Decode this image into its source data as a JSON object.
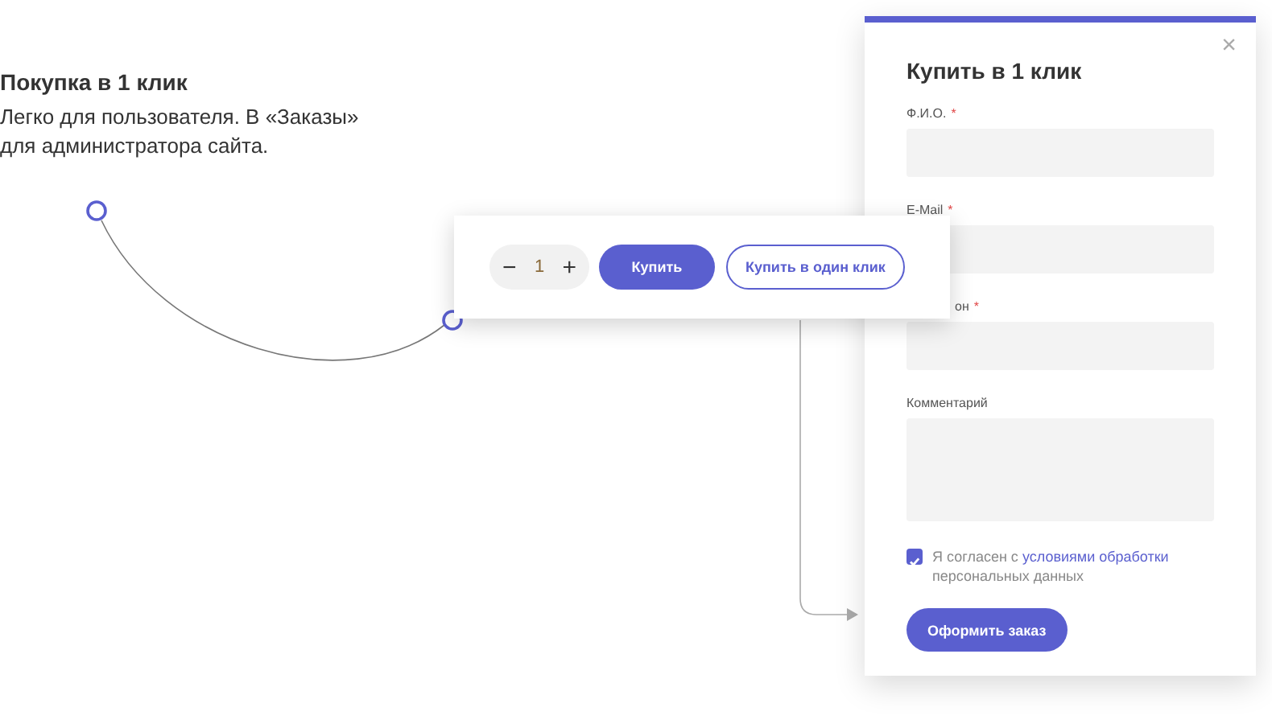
{
  "callout": {
    "title": "Покупка в 1 клик",
    "description": "Легко для пользователя. В «Заказы» для администратора сайта."
  },
  "product_card": {
    "decrease": "−",
    "quantity": "1",
    "increase": "+",
    "buttons": [
      {
        "label": "Купить",
        "kind": "filled"
      },
      {
        "label": "Купить в один клик",
        "kind": "outline"
      }
    ]
  },
  "modal": {
    "title": "Купить в 1 клик",
    "close": "×",
    "fields": [
      {
        "label": "Ф.И.О.",
        "required_mark": "*",
        "kind": "input"
      },
      {
        "label": "E-Mail",
        "required_mark": "*",
        "kind": "input"
      },
      {
        "label": "он",
        "required_mark": "*",
        "kind": "input"
      },
      {
        "label": "Комментарий",
        "kind": "textarea"
      }
    ],
    "consent": {
      "checked": true,
      "text_before": "Я согласен с",
      "link": "условиями обработки",
      "text_after": "персональных данных"
    },
    "submit": "Оформить заказ"
  }
}
